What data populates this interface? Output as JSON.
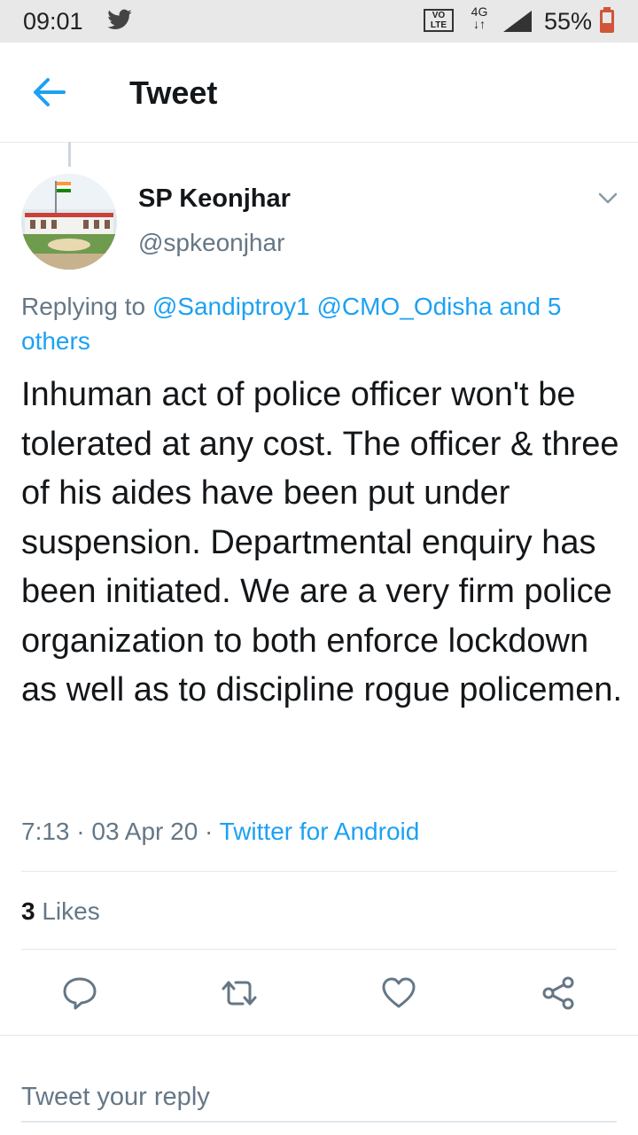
{
  "status_bar": {
    "time": "09:01",
    "volte": "VO LTE",
    "network": "4G",
    "battery": "55%"
  },
  "appbar": {
    "title": "Tweet"
  },
  "tweet": {
    "name": "SP Keonjhar",
    "handle": "@spkeonjhar",
    "replying_prefix": "Replying to",
    "replying_targets": "@Sandiptroy1 @CMO_Odisha and 5 others",
    "text": "Inhuman act of police officer won't be tolerated at any cost. The officer & three of his aides have been put under suspension. Departmental enquiry has been initiated. We are a very firm police organization to both enforce lockdown as well as to discipline rogue policemen.",
    "time": "7:13",
    "date": "03 Apr 20",
    "source": "Twitter for Android",
    "likes_count": "3",
    "likes_label": "Likes"
  },
  "reply": {
    "placeholder": "Tweet your reply"
  },
  "colors": {
    "accent": "#1da1f2",
    "secondary": "#657786",
    "divider": "#e1e8ed"
  }
}
